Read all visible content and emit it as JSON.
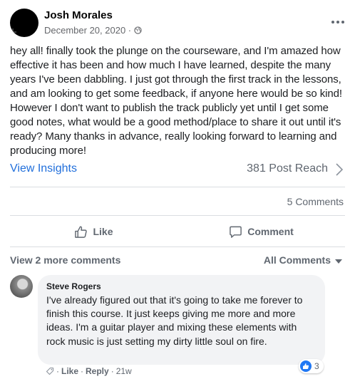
{
  "post": {
    "author": "Josh Morales",
    "date": "December 20, 2020 ·",
    "text": "hey all! finally took the plunge on the courseware, and I'm amazed how effective it has been and how much I have learned, despite the many years I've been dabbling. I just got through the first track in the lessons, and am looking to get some feedback, if anyone here would be so kind! However I don't want to publish the track publicly yet until I get some good notes, what would be a good method/place to share it out until it's ready? Many thanks in advance, really looking forward to learning and producing more!",
    "privacy_icon": "globe-icon",
    "menu_icon": "more-icon"
  },
  "insights": {
    "link": "View Insights",
    "reach": "381 Post Reach"
  },
  "stats": {
    "comments": "5 Comments"
  },
  "actions": {
    "like": "Like",
    "comment": "Comment"
  },
  "comments_bar": {
    "view_more": "View 2 more comments",
    "filter": "All Comments"
  },
  "comment": {
    "author": "Steve Rogers",
    "text": "I've already figured out that it's going to take me forever to finish this course. It just keeps giving me more and more ideas. I'm a guitar player and mixing these elements with rock music is just setting my dirty little soul on fire.",
    "reaction_count": "3",
    "like": "Like",
    "reply": "Reply",
    "time": "21w",
    "sep": "·"
  },
  "colors": {
    "link_blue": "#216fdb",
    "secondary_text": "#606770",
    "bubble_bg": "#f2f3f5",
    "like_badge": "#2078f4"
  }
}
